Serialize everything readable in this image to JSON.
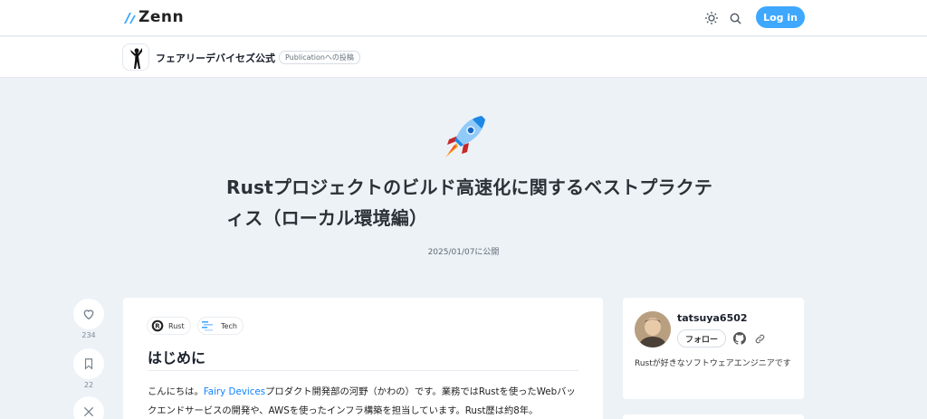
{
  "header": {
    "logo_text": "Zenn",
    "login_label": "Log in",
    "icons": [
      "theme-toggle-icon",
      "search-icon"
    ]
  },
  "publication": {
    "name": "フェアリーデバイセズ公式",
    "badge": "Publicationへの投稿"
  },
  "article": {
    "emoji": "rocket",
    "title": "Rustプロジェクトのビルド高速化に関するベストプラクティス（ローカル環境編）",
    "date": "2025/01/07に公開",
    "likes": "234",
    "bookmarks": "22",
    "topics": [
      {
        "label": "Rust",
        "icon": "rust-icon"
      },
      {
        "label": "Tech",
        "icon": "tech-icon"
      }
    ],
    "heading": "はじめに",
    "paragraph": {
      "before_link": "こんにちは。",
      "link_text": "Fairy Devices",
      "after_link": "プロダクト開発部の河野（かわの）です。業務ではRustを使ったWebバックエンドサービスの開発や、AWSを使ったインフラ構築を担当しています。Rust歴は約8年。"
    }
  },
  "author": {
    "name": "tatsuya6502",
    "follow_label": "フォロー",
    "bio": "Rustが好きなソフトウェアエンジニアです"
  },
  "colors": {
    "accent": "#3ea8ff",
    "link": "#0f83fd",
    "page_bg": "#edf2f7"
  }
}
